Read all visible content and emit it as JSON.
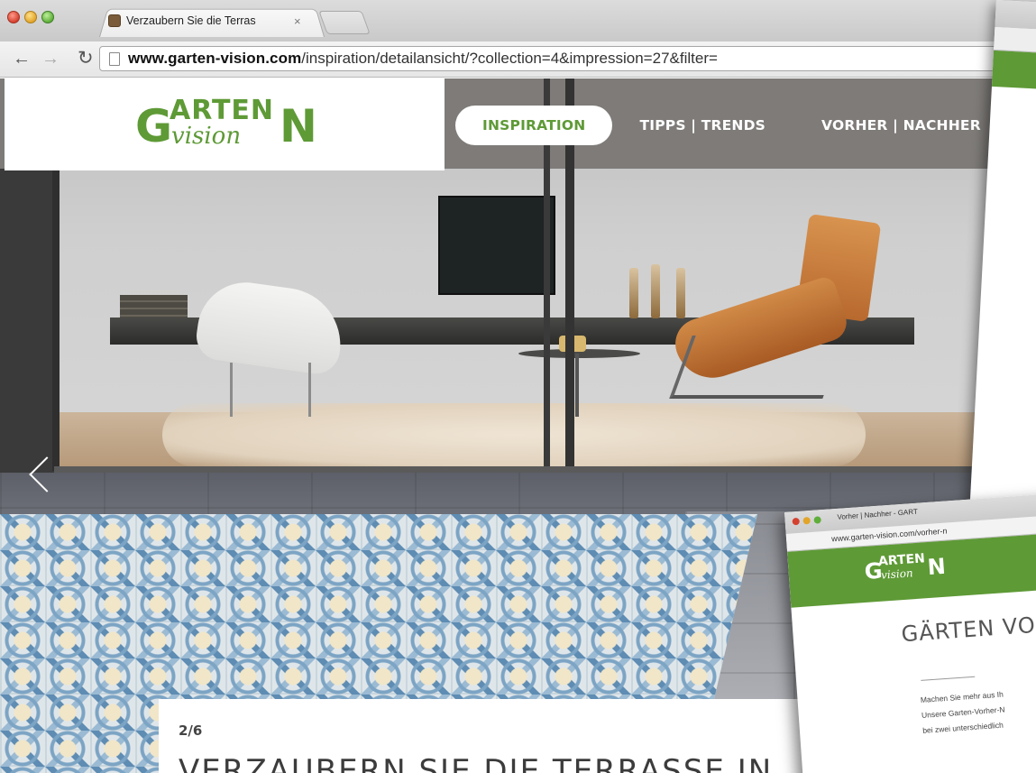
{
  "browser": {
    "tab_title": "Verzaubern Sie die Terras",
    "tab_close": "×",
    "url_host": "www.garten-vision.com",
    "url_path": "/inspiration/detailansicht/?collection=4&impression=27&filter="
  },
  "site": {
    "logo": {
      "g": "G",
      "arten": "ARTEN",
      "vision": "vision",
      "n": "N"
    },
    "nav": [
      {
        "label": "INSPIRATION",
        "active": true
      },
      {
        "label": "TIPPS | TRENDS",
        "active": false
      },
      {
        "label": "VORHER | NACHHER",
        "active": false
      }
    ]
  },
  "slide": {
    "index": "2/6",
    "title": "VERZAUBERN SIE DIE TERRASSE IN"
  },
  "third_window": {
    "tab_title": "Vorher | Nachher - GART",
    "url": "www.garten-vision.com/vorher-n",
    "logo": {
      "g": "G",
      "arten": "ARTEN",
      "vision": "vision",
      "n": "N"
    },
    "heading": "GÄRTEN VOR",
    "text_lines": [
      "Machen Sie mehr aus Ih",
      "Unsere Garten-Vorher-N",
      "bei zwei unterschiedlich"
    ]
  },
  "colors": {
    "brand_green": "#5e9a36",
    "text_dark": "#3c3c3c"
  }
}
